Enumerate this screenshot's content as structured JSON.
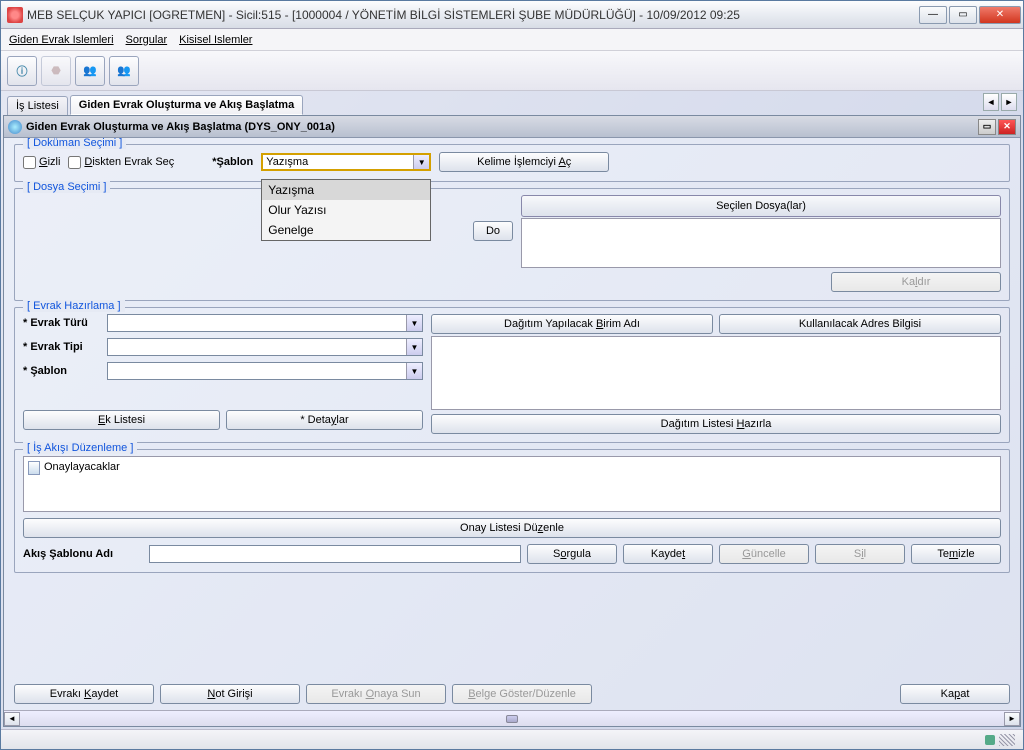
{
  "window": {
    "title": "MEB   SELÇUK YAPICI  [OGRETMEN] - Sicil:515 - [1000004 / YÖNETİM BİLGİ SİSTEMLERİ ŞUBE MÜDÜRLÜĞÜ] - 10/09/2012 09:25"
  },
  "menubar": {
    "giden": "Giden Evrak Islemleri",
    "sorgular": "Sorgular",
    "kisisel": "Kisisel Islemler"
  },
  "tabs": {
    "is_listesi": "İş Listesi",
    "giden_evrak": "Giden Evrak Oluşturma ve Akış Başlatma"
  },
  "subwindow": {
    "title": "Giden Evrak Oluşturma ve Akış Başlatma (DYS_ONY_001a)"
  },
  "dokuman_secimi": {
    "legend": "[ Doküman Seçimi ]",
    "gizli": "Gizli",
    "diskten": "Diskten Evrak Seç",
    "sablon_label": "*Şablon",
    "sablon_value": "Yazışma",
    "options": [
      "Yazışma",
      "Olur Yazısı",
      "Genelge"
    ],
    "kelime_islemci": "Kelime İşlemciyi Aç"
  },
  "dosya_secimi": {
    "legend": "[ Dosya Seçimi ]",
    "dosya_sec_partial": "Do",
    "secilen_dosya": "Seçilen Dosya(lar)",
    "kaldir": "Kaldır"
  },
  "evrak_hazirlama": {
    "legend": "[ Evrak Hazırlama ]",
    "evrak_turu": "* Evrak Türü",
    "evrak_tipi": "* Evrak Tipi",
    "sablon": "* Şablon",
    "ek_listesi": "Ek Listesi",
    "detaylar": "* Detaylar",
    "dagitim_birim": "Dağıtım Yapılacak Birim Adı",
    "adres_bilgisi": "Kullanılacak Adres Bilgisi",
    "dagitim_hazirla": "Dağıtım Listesi Hazırla"
  },
  "is_akisi": {
    "legend": "[ İş Akışı Düzenleme ]",
    "onaylayacaklar": "Onaylayacaklar",
    "onay_listesi_duzenle": "Onay Listesi Düzenle",
    "akis_sablonu_adi": "Akış Şablonu Adı",
    "sorgula": "Sorgula",
    "kaydet": "Kaydet",
    "guncelle": "Güncelle",
    "sil": "Sil",
    "temizle": "Temizle"
  },
  "bottom": {
    "evraki_kaydet": "Evrakı Kaydet",
    "not_girisi": "Not Girişi",
    "evraki_onaya_sun": "Evrakı Onaya Sun",
    "belge_goster": "Belge Göster/Düzenle",
    "kapat": "Kapat"
  }
}
